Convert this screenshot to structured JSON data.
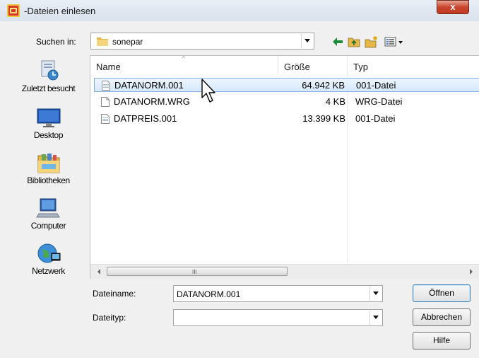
{
  "window": {
    "title": "-Dateien einlesen",
    "close_label": "x",
    "app_icon": "app-logo-icon"
  },
  "lookin": {
    "label": "Suchen in:",
    "value": "sonepar",
    "folder_icon": "folder-icon"
  },
  "toolbar": {
    "icons": [
      "back-arrow-icon",
      "up-folder-icon",
      "new-folder-icon",
      "view-menu-icon"
    ]
  },
  "places": [
    {
      "label": "Zuletzt besucht",
      "icon": "recent-places-icon"
    },
    {
      "label": "Desktop",
      "icon": "desktop-icon"
    },
    {
      "label": "Bibliotheken",
      "icon": "libraries-icon"
    },
    {
      "label": "Computer",
      "icon": "computer-icon"
    },
    {
      "label": "Netzwerk",
      "icon": "network-icon"
    }
  ],
  "columns": {
    "name": "Name",
    "size": "Größe",
    "type": "Typ"
  },
  "files": [
    {
      "name": "DATANORM.001",
      "size": "64.942 KB",
      "type": "001-Datei",
      "selected": true,
      "icon": "data-file-icon"
    },
    {
      "name": "DATANORM.WRG",
      "size": "4 KB",
      "type": "WRG-Datei",
      "selected": false,
      "icon": "blank-file-icon"
    },
    {
      "name": "DATPREIS.001",
      "size": "13.399 KB",
      "type": "001-Datei",
      "selected": false,
      "icon": "data-file-icon"
    }
  ],
  "scrollbar": {
    "grip": "III"
  },
  "filename": {
    "label": "Dateiname:",
    "value": "DATANORM.001"
  },
  "filetype": {
    "label": "Dateityp:",
    "value": ""
  },
  "buttons": {
    "open": "Öffnen",
    "cancel": "Abbrechen",
    "help": "Hilfe"
  },
  "colors": {
    "selection_border": "#84acdd",
    "selection_fill": "#d5e8fb",
    "close_button": "#c8452d",
    "back_arrow": "#1e8b3a"
  }
}
